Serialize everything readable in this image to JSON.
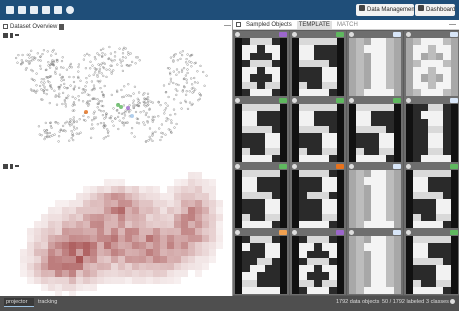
{
  "topbar": {
    "icons": [
      "folder-icon",
      "camera-icon",
      "save-icon",
      "delete-icon",
      "refresh-icon",
      "settings-icon"
    ],
    "data_management_label": "Data Management",
    "dashboard_label": "Dashboard"
  },
  "left_panel": {
    "title": "Dataset Overview",
    "collapse_label": "—"
  },
  "right_panel": {
    "tabs": [
      "Sampled Objects",
      "TEMPLATE",
      "MATCH"
    ],
    "collapse_label": "—",
    "cells": [
      {
        "badge_color": "#9c66cc",
        "digit": "8"
      },
      {
        "badge_color": "#5fb85f",
        "digit": "5"
      },
      {
        "badge_color": "#d8e6f8",
        "digit": "1"
      },
      {
        "badge_color": "#d8e6f8",
        "digit": "8"
      },
      {
        "badge_color": "#5fb85f",
        "digit": "5"
      },
      {
        "badge_color": "#5fb85f",
        "digit": "5"
      },
      {
        "badge_color": "#5fb85f",
        "digit": "5"
      },
      {
        "badge_color": "#d8e6f8",
        "digit": "1"
      },
      {
        "badge_color": "#5fb85f",
        "digit": "5"
      },
      {
        "badge_color": "#e8721c",
        "digit": "3"
      },
      {
        "badge_color": "#d8e6f8",
        "digit": "1"
      },
      {
        "badge_color": "#5fb85f",
        "digit": "5"
      },
      {
        "badge_color": "#f0a050",
        "digit": "2"
      },
      {
        "badge_color": "#9c66cc",
        "digit": "8"
      },
      {
        "badge_color": "#d8e6f8",
        "digit": "1"
      },
      {
        "badge_color": "#5fb85f",
        "digit": "5"
      }
    ]
  },
  "bottombar": {
    "tab_projection": "projector",
    "tab_tracking": "tracking",
    "stat_objects": "1792 data objects",
    "stat_labeled": "50 / 1792 labeled",
    "stat_classes": "3 classes"
  },
  "colors": {
    "topbar": "#1f4e79",
    "right_panel_bg": "#5b5b5b",
    "bottombar": "#4f4f4f",
    "heatmap_base": "#8b1a1a"
  }
}
